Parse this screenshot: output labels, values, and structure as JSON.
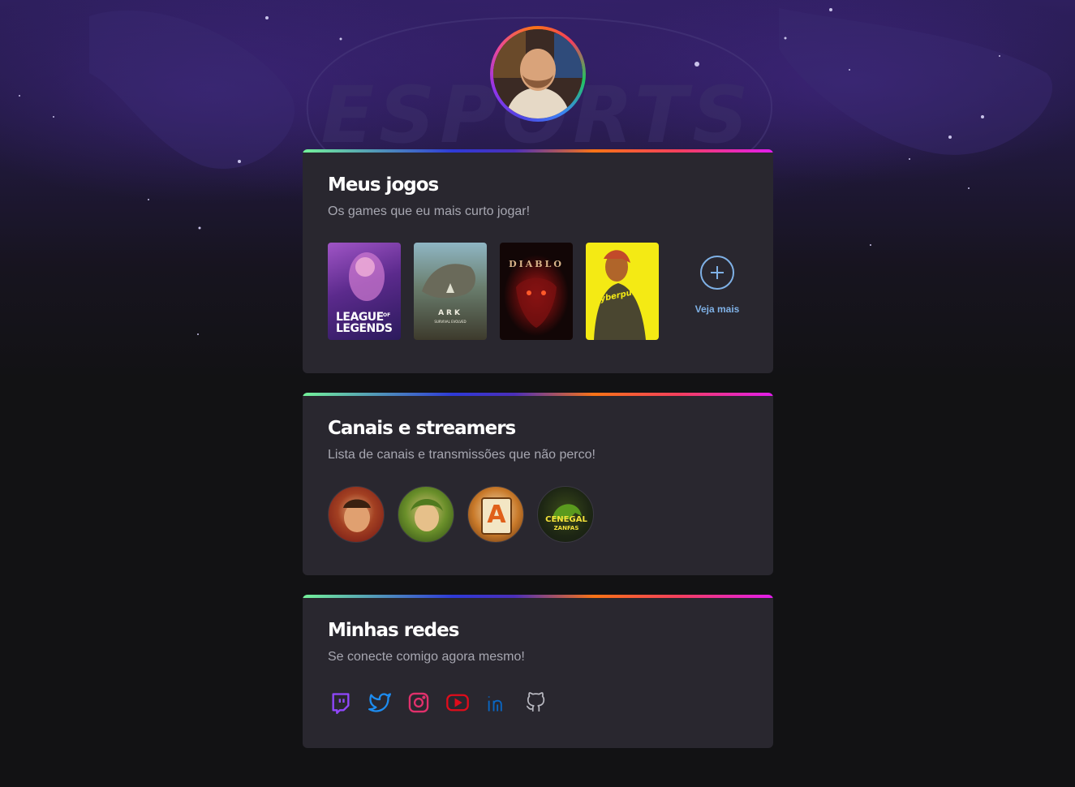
{
  "background": {
    "watermark_text": "ESPORTS"
  },
  "profile": {
    "avatar_icon": "user-photo"
  },
  "games_section": {
    "title": "Meus jogos",
    "subtitle": "Os games que eu mais curto jogar!",
    "games": [
      {
        "name": "League of Legends",
        "cover_text_line1": "LEAGUE",
        "cover_text_of": "OF",
        "cover_text_line2": "LEGENDS"
      },
      {
        "name": "ARK Survival Evolved",
        "cover_text_line1": "ARK",
        "cover_text_line2": "SURVIVAL EVOLVED"
      },
      {
        "name": "Diablo",
        "cover_text_line1": "DIABLO"
      },
      {
        "name": "Cyberpunk",
        "cover_text_line1": "Cyberpunk"
      }
    ],
    "more_label": "Veja mais"
  },
  "channels_section": {
    "title": "Canais e streamers",
    "subtitle": "Lista de canais e transmissões que não perco!",
    "streamers": [
      {
        "icon": "streamer-avatar-1"
      },
      {
        "icon": "streamer-avatar-2"
      },
      {
        "icon": "streamer-avatar-3",
        "logo_text": "A"
      },
      {
        "icon": "streamer-avatar-4",
        "logo_line1": "CENEGAL",
        "logo_line2": "ZANFAS"
      }
    ]
  },
  "social_section": {
    "title": "Minhas redes",
    "subtitle": "Se conecte comigo agora mesmo!",
    "links": [
      {
        "icon": "twitch-icon",
        "color": "#9147ff"
      },
      {
        "icon": "twitter-icon",
        "color": "#1d8cf0"
      },
      {
        "icon": "instagram-icon",
        "color": "#e1306c"
      },
      {
        "icon": "youtube-icon",
        "color": "#e00c1b"
      },
      {
        "icon": "linkedin-icon",
        "color": "#0a66c2"
      },
      {
        "icon": "github-icon",
        "color": "#b8b8c0"
      }
    ]
  },
  "theme": {
    "card_bg": "#29272f",
    "accent_link": "#7fb1e6",
    "gradient_bar": [
      "#74f29a",
      "#2e3ad8",
      "#4b2fb9",
      "#f97316",
      "#f43f5e",
      "#e11ded"
    ]
  }
}
